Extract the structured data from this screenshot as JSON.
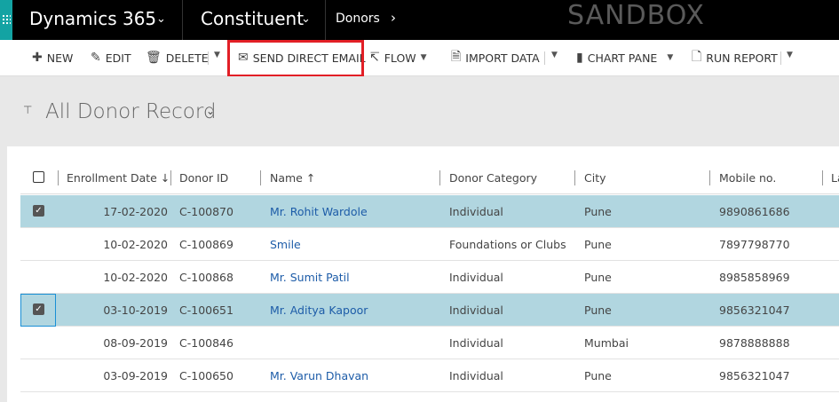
{
  "nav": {
    "app_title": "Dynamics 365",
    "area": "Constituent",
    "entity": "Donors",
    "environment_badge": "SANDBOX"
  },
  "commands": {
    "new": "NEW",
    "edit": "EDIT",
    "delete": "DELETE",
    "send_direct_email": "SEND DIRECT EMAIL",
    "flow": "FLOW",
    "import_data": "IMPORT DATA",
    "chart_pane": "CHART PANE",
    "run_report": "RUN REPORT"
  },
  "view": {
    "title": "All Donor Record"
  },
  "grid": {
    "columns": {
      "enrollment_date": "Enrollment Date",
      "donor_id": "Donor ID",
      "name": "Name",
      "donor_category": "Donor Category",
      "city": "City",
      "mobile": "Mobile no.",
      "last": "La"
    },
    "rows": [
      {
        "date": "17-02-2020",
        "id": "C-100870",
        "name": "Mr. Rohit Wardole",
        "category": "Individual",
        "city": "Pune",
        "mobile": "9890861686",
        "selected": true
      },
      {
        "date": "10-02-2020",
        "id": "C-100869",
        "name": "Smile",
        "category": "Foundations or Clubs",
        "city": "Pune",
        "mobile": "7897798770",
        "selected": false
      },
      {
        "date": "10-02-2020",
        "id": "C-100868",
        "name": "Mr. Sumit Patil",
        "category": "Individual",
        "city": "Pune",
        "mobile": "8985858969",
        "selected": false
      },
      {
        "date": "03-10-2019",
        "id": "C-100651",
        "name": "Mr. Aditya Kapoor",
        "category": "Individual",
        "city": "Pune",
        "mobile": "9856321047",
        "selected": true
      },
      {
        "date": "08-09-2019",
        "id": "C-100846",
        "name": "",
        "category": "Individual",
        "city": "Mumbai",
        "mobile": "9878888888",
        "selected": false
      },
      {
        "date": "03-09-2019",
        "id": "C-100650",
        "name": "Mr. Varun Dhavan",
        "category": "Individual",
        "city": "Pune",
        "mobile": "9856321047",
        "selected": false
      }
    ]
  },
  "colors": {
    "selected_row": "#b1d6e0",
    "link": "#1d5ca8",
    "highlight_box": "#e21f26",
    "waffle": "#13a3a3"
  }
}
